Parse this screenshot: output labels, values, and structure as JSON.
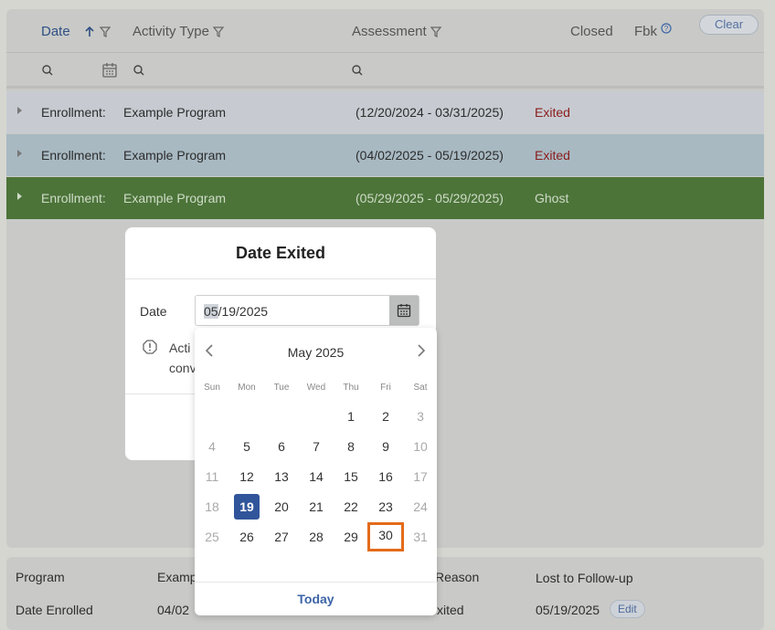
{
  "header": {
    "date_label": "Date",
    "activity_label": "Activity Type",
    "assessment_label": "Assessment",
    "closed_label": "Closed",
    "fbk_label": "Fbk",
    "clear_label": "Clear"
  },
  "rows": [
    {
      "label": "Enrollment:",
      "program": "Example Program",
      "range": "(12/20/2024 - 03/31/2025)",
      "status": "Exited"
    },
    {
      "label": "Enrollment:",
      "program": "Example Program",
      "range": "(04/02/2025 - 05/19/2025)",
      "status": "Exited"
    },
    {
      "label": "Enrollment:",
      "program": "Example Program",
      "range": "(05/29/2025 - 05/29/2025)",
      "status": "Ghost"
    }
  ],
  "detail": {
    "program_label": "Program",
    "program_value": "Examp",
    "date_enrolled_label": "Date Enrolled",
    "date_enrolled_value": "04/02",
    "reason_label": "Reason",
    "reason_value": "Lost to Follow-up",
    "exited_label": "xited",
    "exited_value": "05/19/2025",
    "edit_label": "Edit"
  },
  "dialog": {
    "title": "Date Exited",
    "date_label": "Date",
    "date_value_sel": "05",
    "date_value_rest": "/19/2025",
    "notice_line1": "Acti",
    "notice_line2": "conv"
  },
  "calendar": {
    "month": "May 2025",
    "weekdays": [
      "Sun",
      "Mon",
      "Tue",
      "Wed",
      "Thu",
      "Fri",
      "Sat"
    ],
    "weeks": [
      [
        "",
        "",
        "",
        "",
        "1",
        "2",
        "3"
      ],
      [
        "4",
        "5",
        "6",
        "7",
        "8",
        "9",
        "10"
      ],
      [
        "11",
        "12",
        "13",
        "14",
        "15",
        "16",
        "17"
      ],
      [
        "18",
        "19",
        "20",
        "21",
        "22",
        "23",
        "24"
      ],
      [
        "25",
        "26",
        "27",
        "28",
        "29",
        "30",
        "31"
      ]
    ],
    "selected_day": "19",
    "focused_day": "30",
    "today_label": "Today"
  },
  "colors": {
    "accent": "#31559a",
    "focus_outline": "#e36b1b",
    "exited_status": "#8a1c1c",
    "ghost_row": "#4c7439"
  }
}
